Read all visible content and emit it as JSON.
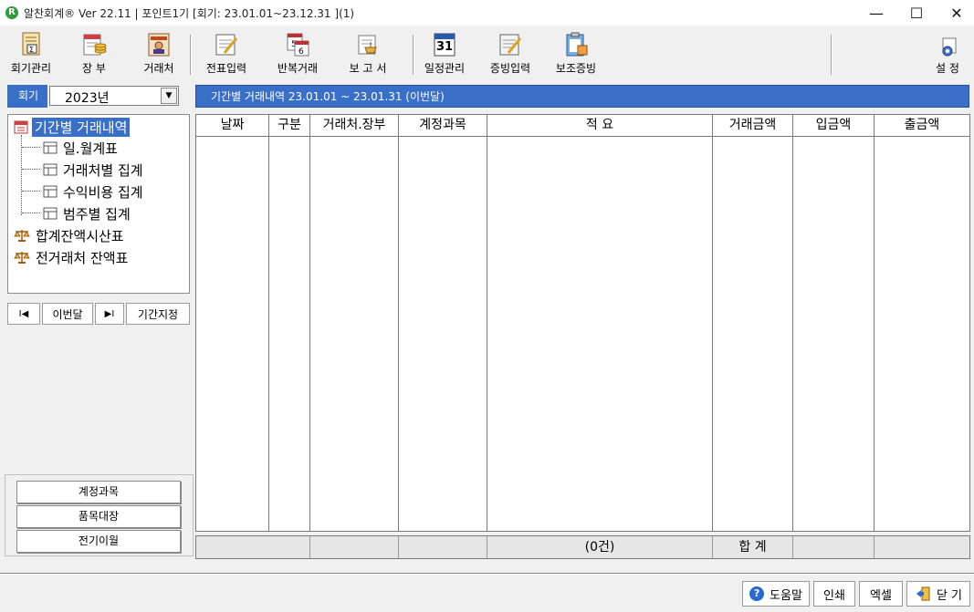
{
  "window": {
    "title": "알찬회계® Ver 22.11 | 포인트1기 [회기: 23.01.01~23.12.31 ](1)",
    "app_icon": "R",
    "minimize": "—",
    "maximize": "☐",
    "close": "✕"
  },
  "toolbar": {
    "items": [
      {
        "label": "회기관리",
        "icon": "ledger-icon"
      },
      {
        "label": "장 부",
        "icon": "book-icon"
      },
      {
        "label": "거래처",
        "icon": "contact-card-icon"
      },
      {
        "label": "전표입력",
        "icon": "voucher-edit-icon"
      },
      {
        "label": "반복거래",
        "icon": "repeat-calendar-icon"
      },
      {
        "label": "보 고 서",
        "icon": "report-icon"
      },
      {
        "label": "일정관리",
        "icon": "calendar-icon"
      },
      {
        "label": "증빙입력",
        "icon": "evidence-edit-icon"
      },
      {
        "label": "보조증빙",
        "icon": "clipboard-icon"
      },
      {
        "label": "설 정",
        "icon": "settings-gear-icon"
      }
    ],
    "calendar_day": "31"
  },
  "year": {
    "label": "회기",
    "value": "2023년",
    "dropdown_glyph": "▼"
  },
  "tree": {
    "items": [
      {
        "label": "기간별 거래내역",
        "selected": true
      },
      {
        "label": "일.월계표"
      },
      {
        "label": "거래처별 집계"
      },
      {
        "label": "수익비용 집계"
      },
      {
        "label": "범주별 집계"
      },
      {
        "label": "합계잔액시산표"
      },
      {
        "label": "전거래처 잔액표"
      }
    ]
  },
  "nav": {
    "first": "I◀",
    "this_month": "이번달",
    "next": "▶I",
    "period": "기간지정"
  },
  "side_buttons": [
    "계정과목",
    "품목대장",
    "전기이월"
  ],
  "main": {
    "header": "기간별 거래내역  23.01.01 ~ 23.01.31 (이번달)",
    "columns": [
      "날짜",
      "구분",
      "거래처.장부",
      "계정과목",
      "적 요",
      "거래금액",
      "입금액",
      "출금액"
    ],
    "rows": [],
    "footer": {
      "count": "(0건)",
      "total_label": "합 계"
    }
  },
  "bottom_buttons": {
    "help": "도움말",
    "print": "인쇄",
    "excel": "엑셀",
    "close": "닫 기"
  },
  "colors": {
    "accent": "#3a6fc8",
    "background": "#f0f0f0"
  }
}
